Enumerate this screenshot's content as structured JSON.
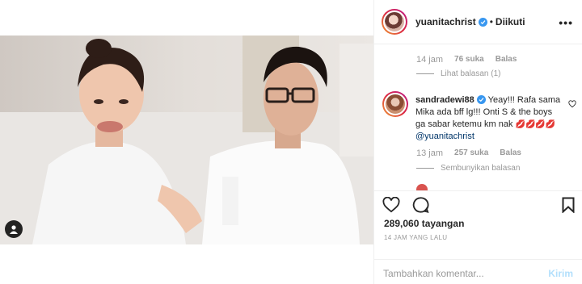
{
  "header": {
    "username": "yuanitachrist",
    "dot": "•",
    "follow_status": "Diikuti",
    "more": "•••"
  },
  "comments": {
    "prev_meta": {
      "time": "14 jam",
      "likes": "76 suka",
      "reply": "Balas"
    },
    "prev_view_replies": "Lihat balasan (1)",
    "comment": {
      "username": "sandradewi88",
      "text": "Yeay!!! Rafa sama Mika ada bff lg!!! Onti S & the boys ga sabar ketemu km nak",
      "emoji": "💋💋💋💋",
      "mention": "@yuanitachrist",
      "time": "13 jam",
      "likes": "257 suka",
      "reply": "Balas",
      "hide_replies": "Sembunyikan balasan"
    }
  },
  "actions": {
    "views": "289,060 tayangan",
    "timestamp": "14 JAM YANG LALU"
  },
  "add_comment": {
    "placeholder": "Tambahkan komentar...",
    "send_label": "Kirim"
  },
  "colors": {
    "verified": "#3897f0",
    "send_disabled": "#b2dffc",
    "mention": "#003569"
  }
}
